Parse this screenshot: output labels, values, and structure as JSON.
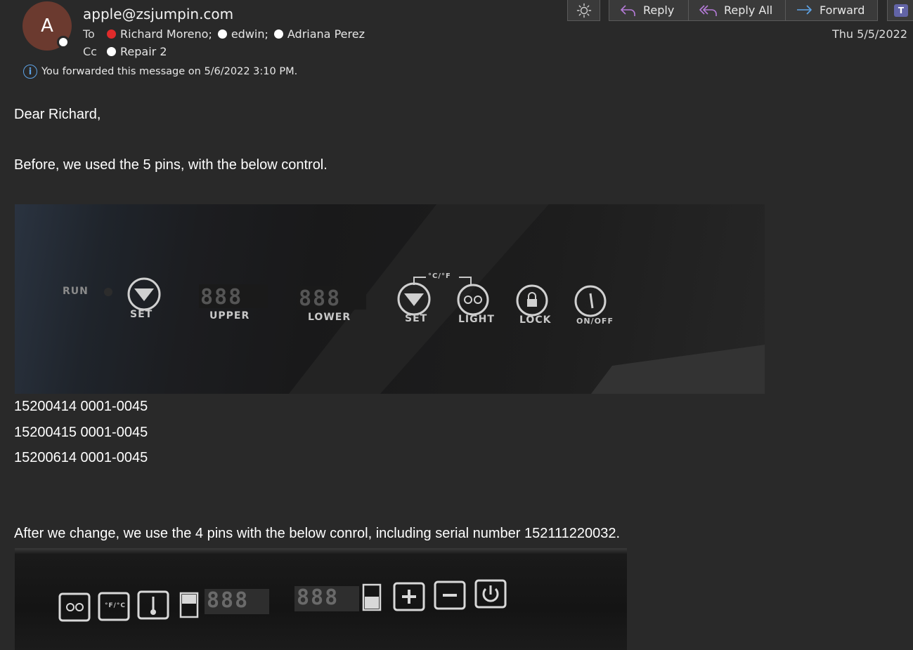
{
  "header": {
    "avatar_initial": "A",
    "sender": "apple@zsjumpin.com",
    "to_label": "To",
    "to": [
      {
        "name": "Richard Moreno;",
        "status": "red"
      },
      {
        "name": "edwin;",
        "status": "white"
      },
      {
        "name": "Adriana Perez",
        "status": "white"
      }
    ],
    "cc_label": "Cc",
    "cc": [
      {
        "name": "Repair 2",
        "status": "white"
      }
    ],
    "info_text": "You forwarded this message on 5/6/2022 3:10 PM.",
    "date": "Thu 5/5/2022"
  },
  "toolbar": {
    "reply": "Reply",
    "reply_all": "Reply All",
    "forward": "Forward",
    "teams_letter": "T"
  },
  "email": {
    "greeting": "Dear Richard,",
    "para1": "Before, we used the 5 pins, with the below control.",
    "serials": [
      "15200414 0001-0045",
      "15200415 0001-0045",
      "15200614 0001-0045"
    ],
    "para2": "After we change, we use the 4 pins with the below conrol, including serial number 152111220032."
  },
  "panel1": {
    "run": "RUN",
    "set": "SET",
    "upper": "UPPER",
    "lower": "LOWER",
    "set2": "SET",
    "unit_toggle": "°C/°F",
    "light": "LIGHT",
    "lock": "LOCK",
    "onoff": "ON/OFF",
    "digits": "888"
  },
  "panel2": {
    "unit_toggle": "°F/°C",
    "digits": "888"
  },
  "colors": {
    "background": "#292929",
    "presence_red": "#e02b2b",
    "info_blue": "#5ea3e6",
    "reply_purple": "#b57bd8",
    "forward_blue": "#5ea3e6",
    "teams": "#6264a7"
  }
}
